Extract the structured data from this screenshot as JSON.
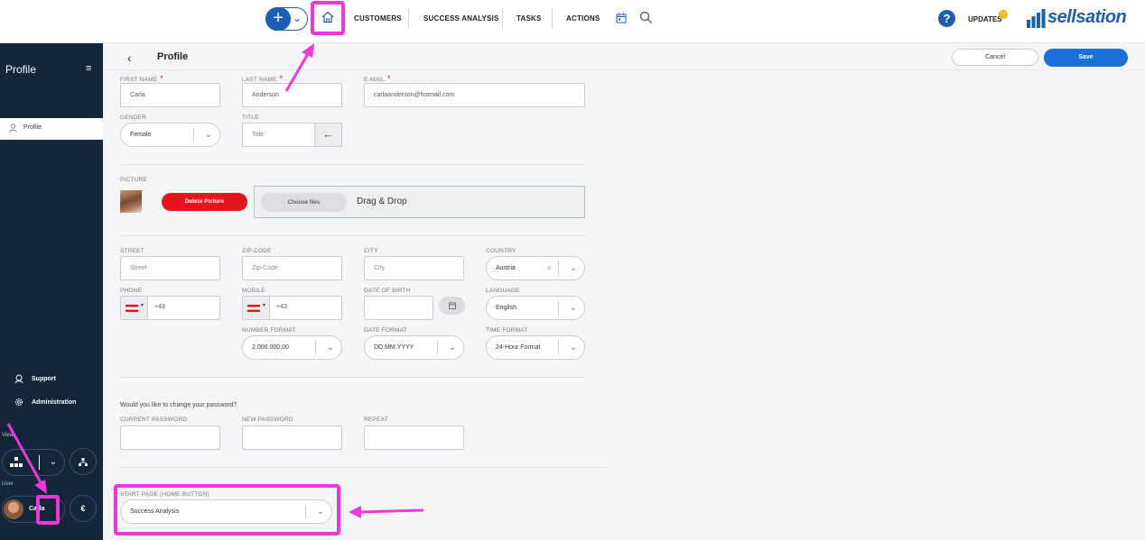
{
  "topbar": {
    "add_symbol": "+",
    "nav": [
      "CUSTOMERS",
      "SUCCESS ANALYSIS",
      "TASKS",
      "ACTIONS"
    ],
    "help_symbol": "?",
    "updates_label": "UPDATES",
    "updates_count": "10",
    "logo_text": "sellsation"
  },
  "sidebar": {
    "title": "Profile",
    "menu_symbol": "≡",
    "active_item": "Profile",
    "support_label": "Support",
    "administration_label": "Administration",
    "view_label": "View",
    "user_label": "User",
    "user_name": "Carla",
    "currency_symbol": "€"
  },
  "header": {
    "back_symbol": "‹",
    "page_title": "Profile",
    "cancel_label": "Cancel",
    "save_label": "Save"
  },
  "form": {
    "first_name": {
      "label": "FIRST NAME",
      "value": "Carla"
    },
    "last_name": {
      "label": "LAST NAME",
      "value": "Anderson"
    },
    "email": {
      "label": "E-MAIL",
      "value": "carlaanderson@hotmail.com"
    },
    "gender": {
      "label": "GENDER",
      "value": "Female"
    },
    "title": {
      "label": "TITLE",
      "placeholder": "Title"
    },
    "picture": {
      "label": "PICTURE",
      "delete_label": "Delete Picture",
      "choose_label": "Choose files",
      "drop_label": "Drag & Drop"
    },
    "street": {
      "label": "STREET",
      "placeholder": "Street"
    },
    "zip": {
      "label": "ZIP-CODE",
      "placeholder": "Zip-Code"
    },
    "city": {
      "label": "CITY",
      "placeholder": "City"
    },
    "country": {
      "label": "COUNTRY",
      "value": "Austria"
    },
    "phone": {
      "label": "PHONE",
      "value": "+43"
    },
    "mobile": {
      "label": "MOBILE",
      "value": "+43"
    },
    "dob": {
      "label": "DATE OF BIRTH"
    },
    "language": {
      "label": "LANGUAGE",
      "value": "English"
    },
    "number_format": {
      "label": "NUMBER FORMAT",
      "value": "2.000.000,00"
    },
    "date_format": {
      "label": "DATE FORMAT",
      "value": "DD.MM.YYYY"
    },
    "time_format": {
      "label": "TIME FORMAT",
      "value": "24-Hour Format"
    },
    "password_question": "Would you like to change your password?",
    "current_password": {
      "label": "CURRENT PASSWORD"
    },
    "new_password": {
      "label": "NEW PASSWORD"
    },
    "repeat": {
      "label": "REPEAT"
    },
    "start_page": {
      "label": "START PAGE (HOME BUTTON)",
      "value": "Success Analysis"
    }
  },
  "colors": {
    "accent": "#1a5fb4",
    "sidebar": "#13263a",
    "danger": "#e8141c",
    "highlight": "#ee36e0"
  }
}
